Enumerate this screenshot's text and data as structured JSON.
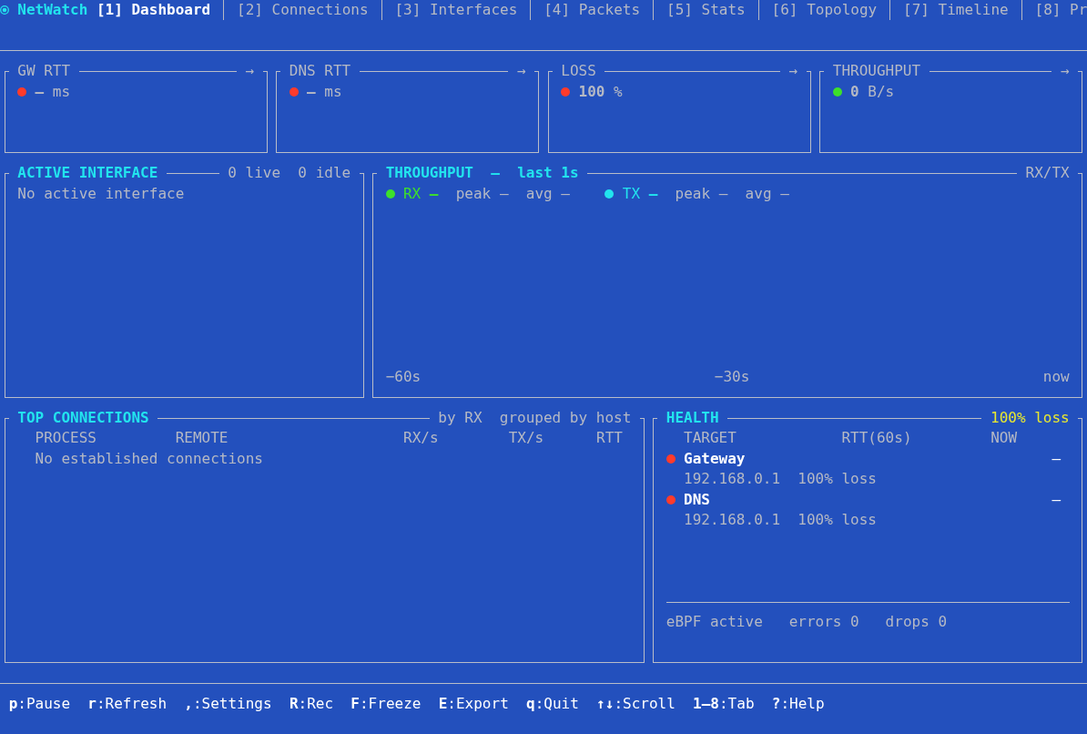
{
  "app": {
    "name": "NetWatch"
  },
  "tabs": [
    {
      "label": "[1] Dashboard",
      "selected": true
    },
    {
      "label": "[2] Connections",
      "selected": false
    },
    {
      "label": "[3] Interfaces",
      "selected": false
    },
    {
      "label": "[4] Packets",
      "selected": false
    },
    {
      "label": "[5] Stats",
      "selected": false
    },
    {
      "label": "[6] Topology",
      "selected": false
    },
    {
      "label": "[7] Timeline",
      "selected": false
    },
    {
      "label": "[8] Pr",
      "selected": false
    }
  ],
  "stat_cards": [
    {
      "title": "GW RTT",
      "arrow": "→",
      "color": "#ff3b2b",
      "reading": "**—** ms"
    },
    {
      "title": "DNS RTT",
      "arrow": "→",
      "color": "#ff3b2b",
      "reading": "**—** ms"
    },
    {
      "title": "LOSS",
      "arrow": "→",
      "color": "#ff3b2b",
      "reading": "**100** %"
    },
    {
      "title": "THROUGHPUT",
      "arrow": "→",
      "color": "#3de02b",
      "reading": "**0** B/s"
    }
  ],
  "active_interface": {
    "title": "ACTIVE INTERFACE",
    "counts": [
      "0 live",
      "0 idle"
    ],
    "message": "No active interface"
  },
  "throughput": {
    "title": "THROUGHPUT  —  last 1s",
    "mode": "RX/TX",
    "series": [
      {
        "name": "RX",
        "color": "#3de02b",
        "current": "—",
        "peak": "peak —",
        "avg": "avg —"
      },
      {
        "name": "TX",
        "color": "#22e4ee",
        "current": "—",
        "peak": "peak —",
        "avg": "avg —"
      }
    ],
    "time_axis": [
      "−60s",
      "−30s",
      "now"
    ]
  },
  "top_connections": {
    "title": "TOP CONNECTIONS",
    "sort": "by RX",
    "grouping": "grouped by host",
    "columns": [
      "PROCESS",
      "REMOTE",
      "RX/s",
      "TX/s",
      "RTT"
    ],
    "message": "No established connections"
  },
  "health": {
    "title": "HEALTH",
    "summary": "100% loss",
    "columns": [
      "TARGET",
      "RTT(60s)",
      "NOW"
    ],
    "targets": [
      {
        "name": "Gateway",
        "color": "#ff3b2b",
        "now": "—",
        "address": "192.168.0.1",
        "loss": "100% loss"
      },
      {
        "name": "DNS",
        "color": "#ff3b2b",
        "now": "—",
        "address": "192.168.0.1",
        "loss": "100% loss"
      }
    ],
    "status": [
      "eBPF active",
      "errors 0",
      "drops 0"
    ]
  },
  "shortcuts": [
    "**p**:Pause",
    "**r**:Refresh",
    "**,**:Settings",
    "**R**:Rec",
    "**F**:Freeze",
    "**E**:Export",
    "**q**:Quit",
    "**↑↓**:Scroll",
    "**1–8**:Tab",
    "**?**:Help"
  ]
}
